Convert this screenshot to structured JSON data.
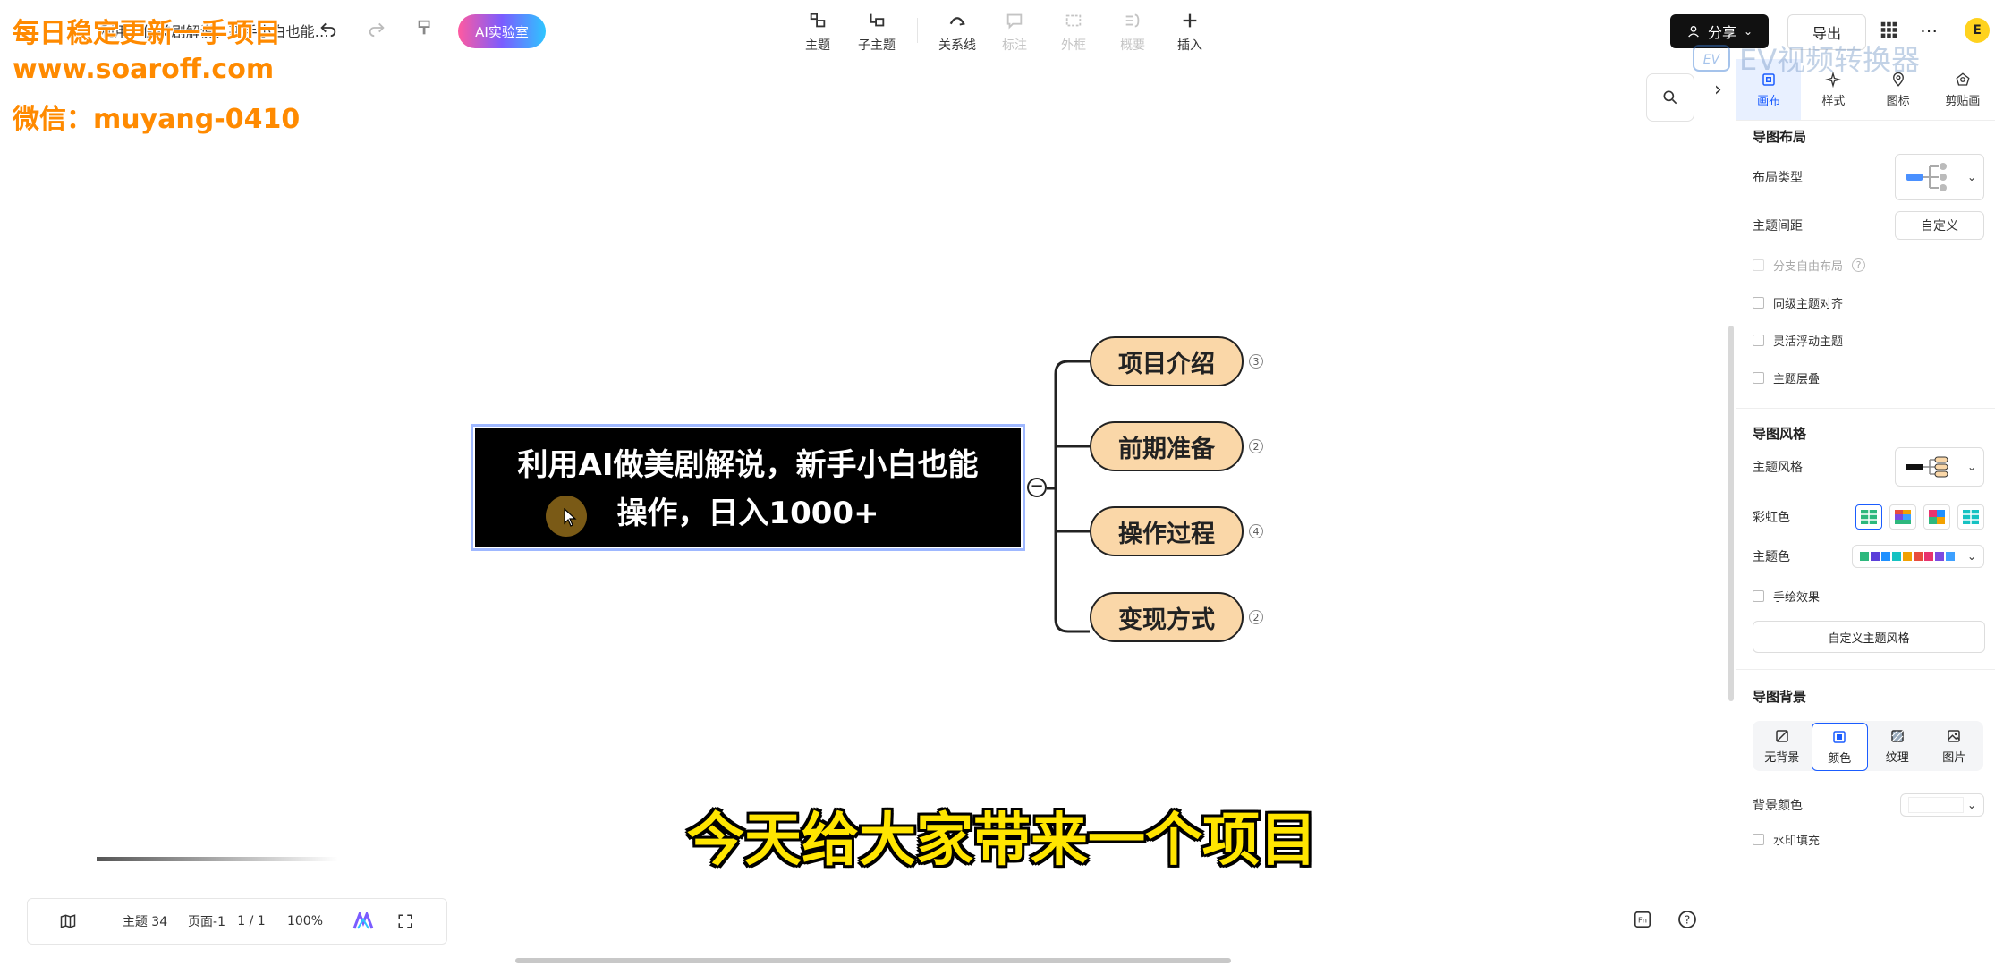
{
  "watermark": {
    "line1": "每日稳定更新一手项目",
    "line2": "www.soaroff.com",
    "line3": "微信：muyang-0410",
    "ev_logo": "EV视频转换器"
  },
  "doc_title": "利用AI做美剧解说，新手小白也能…",
  "ai_lab": "AI实验室",
  "toolbar": {
    "topic": "主题",
    "subtopic": "子主题",
    "relation": "关系线",
    "mark": "标注",
    "boundary": "外框",
    "summary": "概要",
    "insert": "插入"
  },
  "share": "分享",
  "export": "导出",
  "avatar": "E",
  "mindmap": {
    "root_line1": "利用AI做美剧解说，新手小白也能",
    "root_line2": "操作，日入1000+",
    "children": [
      {
        "label": "项目介绍",
        "count": "3"
      },
      {
        "label": "前期准备",
        "count": "2"
      },
      {
        "label": "操作过程",
        "count": "4"
      },
      {
        "label": "变现方式",
        "count": "2"
      }
    ]
  },
  "subtitle": "今天给大家带来一个项目",
  "status": {
    "topics": "主题 34",
    "page": "页面-1",
    "page_num": "1 / 1",
    "zoom": "100%"
  },
  "panel": {
    "tabs": [
      "画布",
      "样式",
      "图标",
      "剪贴画"
    ],
    "layout_section": "导图布局",
    "layout_type": "布局类型",
    "topic_spacing": "主题间距",
    "custom": "自定义",
    "branch_free": "分支自由布局",
    "align_same": "同级主题对齐",
    "float_topic": "灵活浮动主题",
    "overlap": "主题层叠",
    "style_section": "导图风格",
    "theme_style": "主题风格",
    "rainbow": "彩虹色",
    "theme_color": "主题色",
    "hand_drawn": "手绘效果",
    "custom_theme": "自定义主题风格",
    "bg_section": "导图背景",
    "bg_tabs": [
      "无背景",
      "颜色",
      "纹理",
      "图片"
    ],
    "bg_color": "背景颜色",
    "watermark_fill": "水印填充"
  },
  "colors": {
    "node_fill": "#fad7a8",
    "root_fill": "#000000",
    "accent": "#1a5cff",
    "palette": [
      "#2db87d",
      "#5b3fd9",
      "#1e90ff",
      "#16c2c2",
      "#f2a100",
      "#e84c3d",
      "#e8336d",
      "#7b4ae0",
      "#3da0ff"
    ]
  }
}
